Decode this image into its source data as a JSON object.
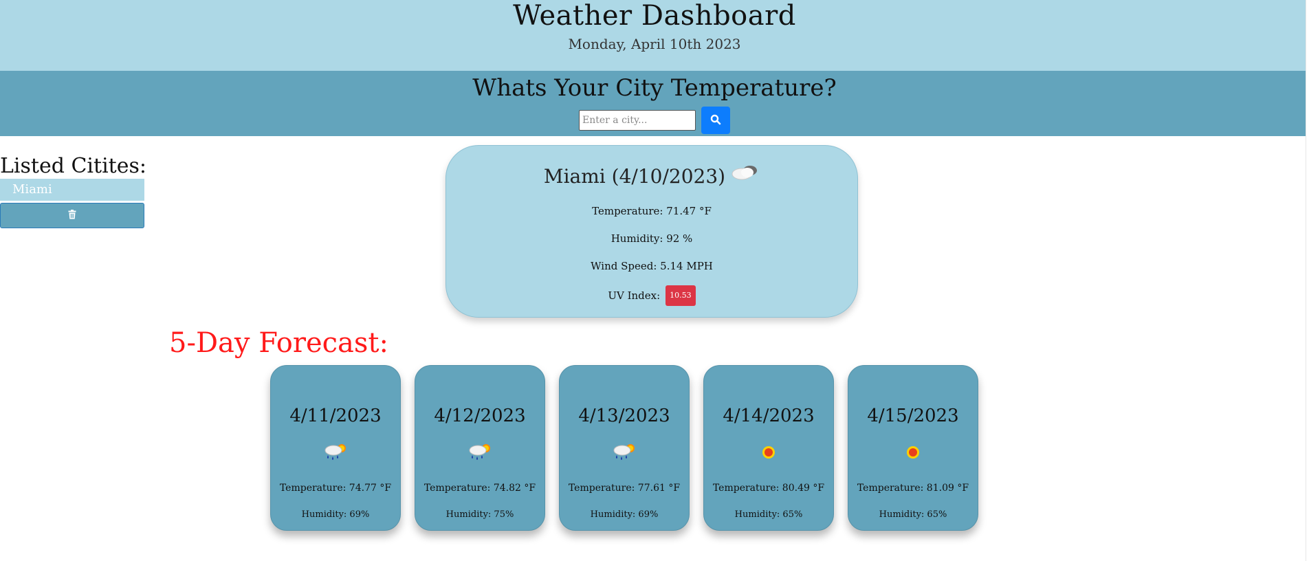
{
  "header": {
    "title": "Weather Dashboard",
    "date": "Monday, April 10th 2023"
  },
  "search": {
    "question": "Whats Your City Temperature?",
    "placeholder": "Enter a city...",
    "button_icon": "search-icon",
    "button_color": "#0d7dfd"
  },
  "sidebar": {
    "heading": "Listed Citites:",
    "cities": [
      "Miami"
    ],
    "clear_icon": "trash-icon"
  },
  "current": {
    "city_date": "Miami (4/10/2023)",
    "icon": "partly-cloudy-icon",
    "temperature": "Temperature: 71.47 °F",
    "humidity": "Humidity: 92 %",
    "wind": "Wind Speed: 5.14 MPH",
    "uv_label": "UV Index:",
    "uv_value": "10.53",
    "uv_color": "#dc3545"
  },
  "forecast": {
    "heading": "5-Day Forecast:",
    "heading_color": "#ff1a1a",
    "days": [
      {
        "date": "4/11/2023",
        "icon": "rain-sun-icon",
        "temperature": "Temperature: 74.77 °F",
        "humidity": "Humidity: 69%"
      },
      {
        "date": "4/12/2023",
        "icon": "rain-sun-icon",
        "temperature": "Temperature: 74.82 °F",
        "humidity": "Humidity: 75%"
      },
      {
        "date": "4/13/2023",
        "icon": "rain-sun-icon",
        "temperature": "Temperature: 77.61 °F",
        "humidity": "Humidity: 69%"
      },
      {
        "date": "4/14/2023",
        "icon": "sun-icon",
        "temperature": "Temperature: 80.49 °F",
        "humidity": "Humidity: 65%"
      },
      {
        "date": "4/15/2023",
        "icon": "sun-icon",
        "temperature": "Temperature: 81.09 °F",
        "humidity": "Humidity: 65%"
      }
    ]
  },
  "colors": {
    "header_bg": "#add8e6",
    "search_bg": "#63a4bc",
    "card_bg": "#add8e6",
    "forecast_card_bg": "#63a4bc"
  }
}
